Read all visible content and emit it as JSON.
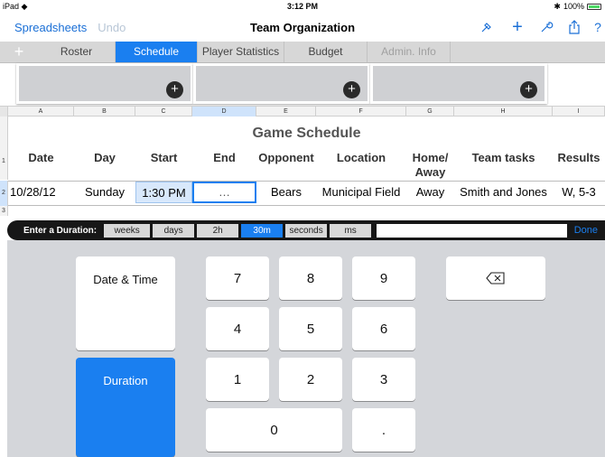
{
  "status": {
    "device": "iPad",
    "time": "3:12 PM",
    "battery": "100%"
  },
  "toolbar": {
    "spreadsheets": "Spreadsheets",
    "undo": "Undo",
    "title": "Team Organization",
    "question": "?"
  },
  "tabs": [
    {
      "label": "Roster"
    },
    {
      "label": "Schedule"
    },
    {
      "label": "Player Statistics"
    },
    {
      "label": "Budget"
    },
    {
      "label": "Admin. Info"
    }
  ],
  "columns": [
    "A",
    "B",
    "C",
    "D",
    "E",
    "F",
    "G",
    "H",
    "I"
  ],
  "rows": [
    "1",
    "2",
    "3"
  ],
  "table": {
    "title": "Game Schedule",
    "headers": [
      "Date",
      "Day",
      "Start",
      "End",
      "Opponent",
      "Location",
      "Home/\nAway",
      "Team tasks",
      "Results"
    ],
    "row": [
      "10/28/12",
      "Sunday",
      "1:30 PM",
      "…",
      "Bears",
      "Municipal Field",
      "Away",
      "Smith and Jones",
      "W, 5-3"
    ]
  },
  "duration_bar": {
    "label": "Enter a Duration:",
    "units": [
      "weeks",
      "days",
      "2h",
      "30m",
      "seconds",
      "ms"
    ],
    "selected_unit": "30m",
    "done": "Done"
  },
  "keyboard": {
    "mode_date": "Date & Time",
    "mode_duration": "Duration",
    "digits": [
      "7",
      "8",
      "9",
      "4",
      "5",
      "6",
      "1",
      "2",
      "3",
      "0",
      "."
    ]
  },
  "colors": {
    "accent": "#1a7ff0"
  }
}
